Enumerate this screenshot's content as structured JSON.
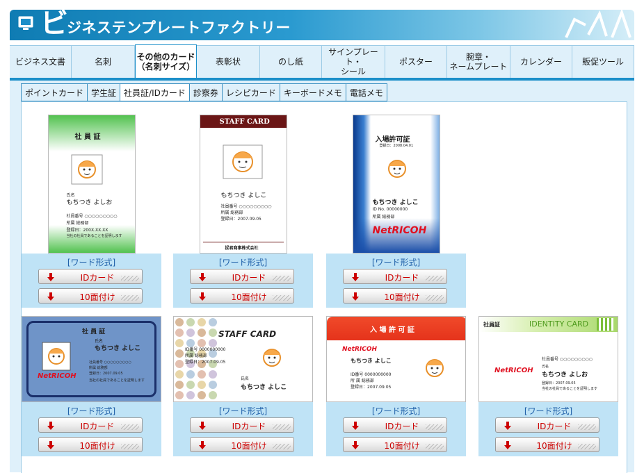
{
  "header": {
    "logo_letter": "ビ",
    "title": "ジネステンプレートファクトリー"
  },
  "nav": [
    {
      "label": "ビジネス文書",
      "width": 89
    },
    {
      "label": "名刺",
      "width": 91
    },
    {
      "label": "その他のカード\n（名刺サイズ）",
      "width": 89,
      "active": true
    },
    {
      "label": "表彰状",
      "width": 91
    },
    {
      "label": "のし紙",
      "width": 89
    },
    {
      "label": "サインプレート・\nシール",
      "width": 91
    },
    {
      "label": "ポスター",
      "width": 89
    },
    {
      "label": "腕章・\nネームプレート",
      "width": 91
    },
    {
      "label": "カレンダー",
      "width": 89
    },
    {
      "label": "販促ツール",
      "width": 89
    }
  ],
  "subnav": [
    {
      "label": "ポイントカード"
    },
    {
      "label": "学生証"
    },
    {
      "label": "社員証/IDカード",
      "active": true
    },
    {
      "label": "診察券"
    },
    {
      "label": "レシピカード"
    },
    {
      "label": "キーボードメモ"
    },
    {
      "label": "電話メモ"
    }
  ],
  "download": {
    "format_label": "[ワード形式]",
    "id_label": "IDカード",
    "multi_label": "10面付け"
  },
  "cards": {
    "c1": {
      "title": "社 員 証",
      "name_label": "氏名",
      "name": "もちつき よしお",
      "id_line": "社員番号 ○○○○○○○○○",
      "dept_line": "所属 総務部",
      "date_line": "登録日：200X.XX.XX",
      "note": "当社の社員であることを証明します"
    },
    "c2": {
      "header": "STAFF CARD",
      "name": "もちつき よしこ",
      "id_line": "社員番号 ○○○○○○○○○",
      "dept_line": "所属 総務部",
      "date_line": "登録日：2007.09.05",
      "company": "捉君商事株式会社"
    },
    "c3": {
      "title": "入場許可証",
      "date": "登録日：2008.04.01",
      "name": "もちつき よしこ",
      "id_line": "ID No. 00000000",
      "dept_line": "所属 総務部",
      "logo": "NetRICOH"
    },
    "c4": {
      "title": "社 員 証",
      "name_label": "氏名",
      "name": "もちつき よしこ",
      "id_line": "社員番号 ○○○○○○○○○",
      "dept_line": "所属 総務部",
      "date_line": "登録日：2007.09.05",
      "note": "当社の社員であることを証明します",
      "logo": "NetRICOH"
    },
    "c5": {
      "header": "STAFF CARD",
      "id_line": "ID番号 0000000000",
      "dept_line": "所属 総務部",
      "date_line": "登録日：2007.09.05",
      "name_label": "氏名",
      "name": "もちつき よしこ"
    },
    "c6": {
      "header": "入 場 許 可 証",
      "logo": "NetRICOH",
      "name": "もちつき よしこ",
      "id_line": "ID番号 0000000000",
      "dept_line": "所 属 総務部",
      "date_line": "登録日：2007.09.05"
    },
    "c7": {
      "left_title": "社員証",
      "right_title": "IDENTITY CARD",
      "logo": "NetRICOH",
      "id_line": "社員番号 ○○○○○○○○○",
      "name_label": "氏名",
      "name": "もちつき よしお",
      "date_line": "登録日：2007.09.05",
      "note": "当社の社員であることを証明します"
    }
  },
  "colors": {
    "accent": "#1c8fc9",
    "nav_bg": "#dff0fa",
    "download_bg": "#bfe3f6",
    "button_text": "#cc0000",
    "format_text": "#1e5fa8"
  }
}
